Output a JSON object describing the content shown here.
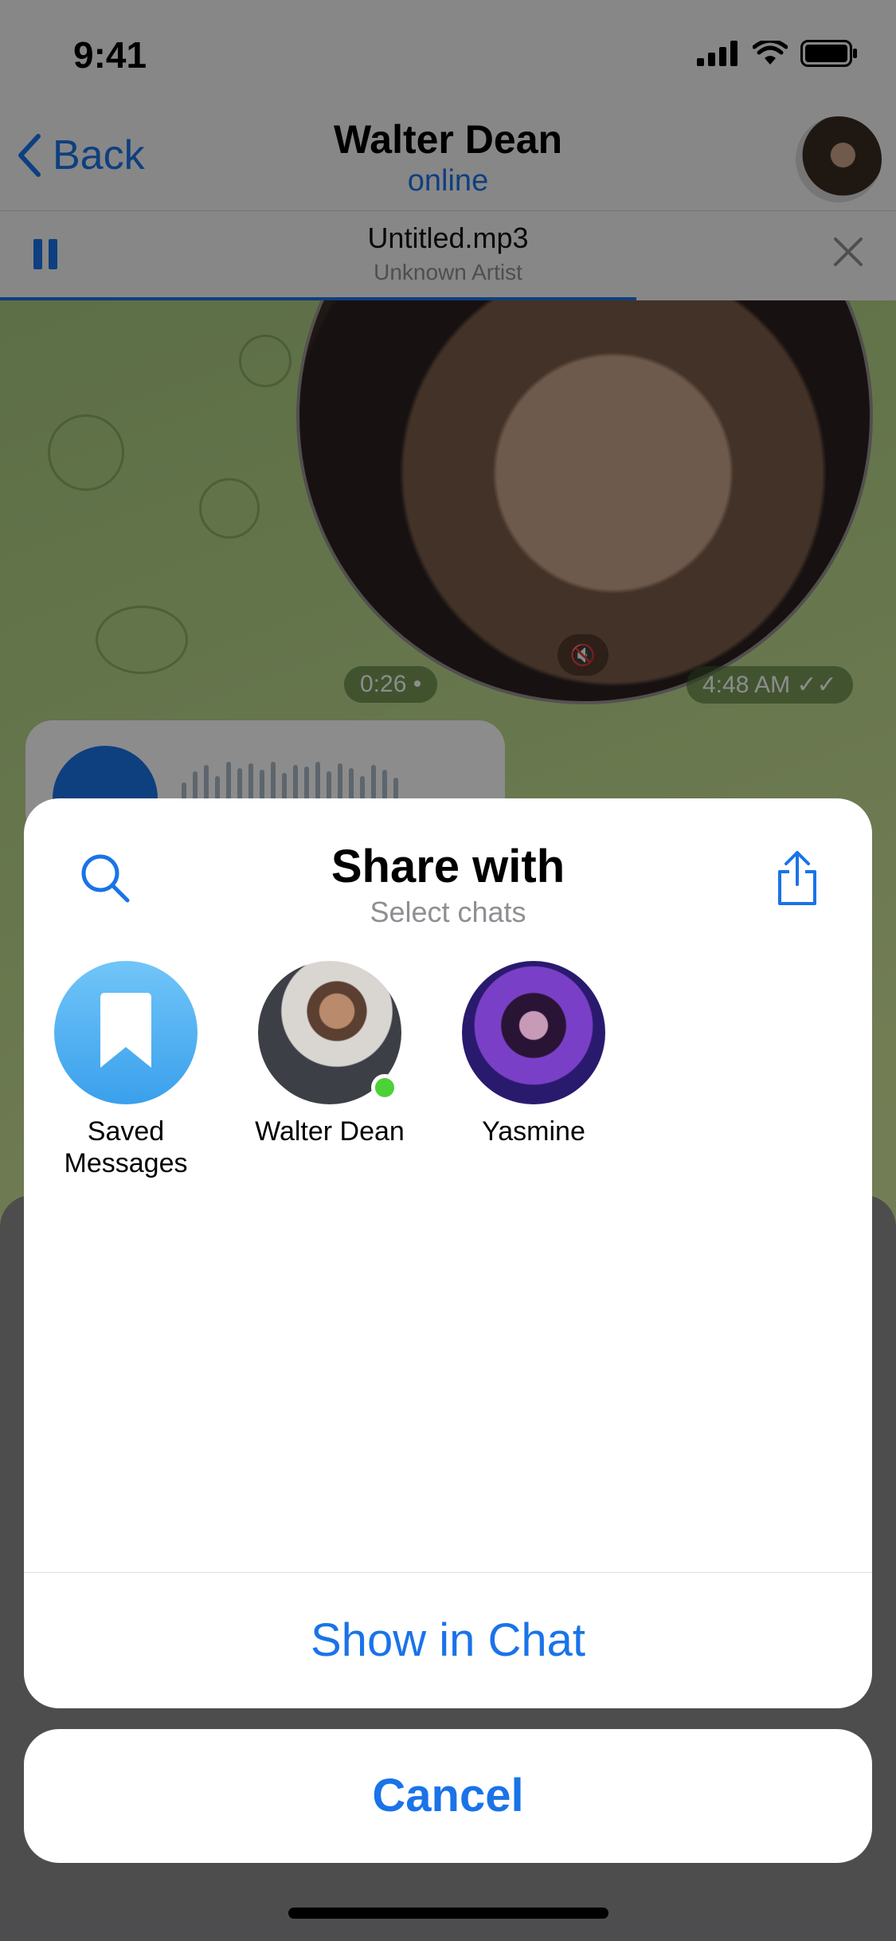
{
  "status_bar": {
    "time": "9:41"
  },
  "nav": {
    "back_label": "Back",
    "title": "Walter Dean",
    "subtitle": "online"
  },
  "player": {
    "track_title": "Untitled.mp3",
    "artist": "Unknown Artist",
    "progress": 0.71
  },
  "chat": {
    "video_duration": "0:26 •",
    "message_time": "4:48 AM"
  },
  "share_sheet": {
    "title": "Share with",
    "subtitle": "Select chats",
    "contacts": [
      {
        "name": "Saved Messages",
        "icon": "bookmark-icon"
      },
      {
        "name": "Walter Dean",
        "online": true
      },
      {
        "name": "Yasmine"
      }
    ],
    "action_label": "Show in Chat"
  },
  "cancel_label": "Cancel",
  "colors": {
    "accent": "#1A73E8",
    "online": "#4CD137",
    "saved_messages": "#48A9F0"
  }
}
